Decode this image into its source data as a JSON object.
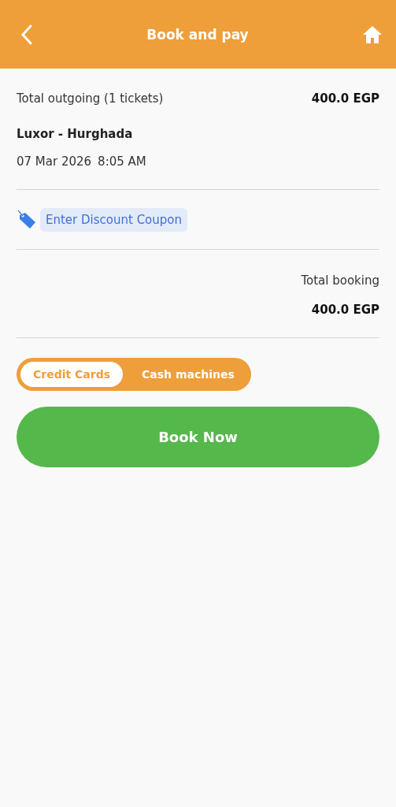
{
  "header": {
    "title": "Book and pay"
  },
  "summary": {
    "label": "Total outgoing (1 tickets)",
    "amount": "400.0 EGP"
  },
  "trip": {
    "route": "Luxor - Hurghada",
    "date": "07 Mar 2026",
    "time": "8:05 AM"
  },
  "coupon": {
    "label": "Enter Discount Coupon"
  },
  "total": {
    "label": "Total booking",
    "amount": "400.0 EGP"
  },
  "payment_methods": [
    {
      "label": "Credit Cards",
      "selected": true
    },
    {
      "label": "Cash machines",
      "selected": false
    }
  ],
  "book_button": {
    "label": "Book Now"
  }
}
